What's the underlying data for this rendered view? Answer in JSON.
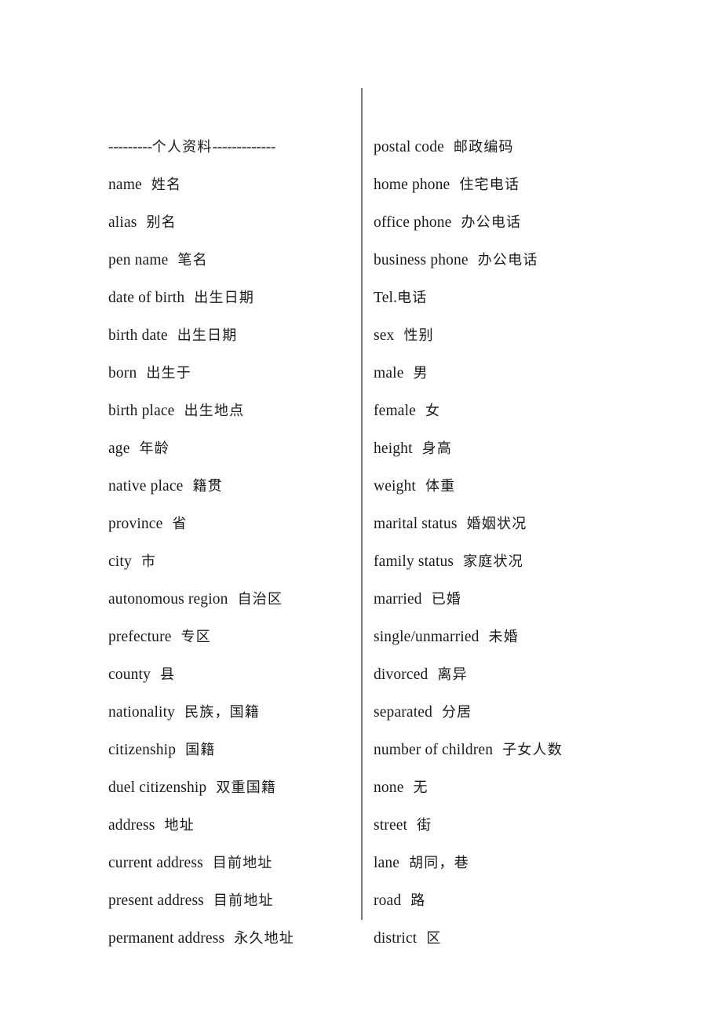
{
  "document": {
    "title": "个人资料 / Personal Information Glossary",
    "background_color": "#ffffff",
    "text_color": "#1a1a1a",
    "divider_color": "#777777"
  },
  "left_column": {
    "header": {
      "leading_dashes": "---------",
      "label": "个人资料",
      "trailing_dashes": "-------------"
    },
    "entries": [
      {
        "en": "name",
        "zh": "姓名",
        "sep": "wide"
      },
      {
        "en": "alias",
        "zh": "别名",
        "sep": "wide"
      },
      {
        "en": "pen name",
        "zh": "笔名",
        "sep": "wide"
      },
      {
        "en": "date of birth",
        "zh": "出生日期",
        "sep": "wide"
      },
      {
        "en": "birth date",
        "zh": "出生日期",
        "sep": "wide"
      },
      {
        "en": "born",
        "zh": "出生于",
        "sep": "wide"
      },
      {
        "en": "birth place",
        "zh": "出生地点",
        "sep": "wide"
      },
      {
        "en": "age",
        "zh": "年龄",
        "sep": "wide"
      },
      {
        "en": "native place",
        "zh": "籍贯",
        "sep": "wide"
      },
      {
        "en": "province",
        "zh": "省",
        "sep": "wide"
      },
      {
        "en": "city",
        "zh": "市",
        "sep": "wide"
      },
      {
        "en": "autonomous region",
        "zh": "自治区",
        "sep": "wide"
      },
      {
        "en": "prefecture",
        "zh": "专区",
        "sep": "wide"
      },
      {
        "en": "county",
        "zh": "县",
        "sep": "wide"
      },
      {
        "en": "nationality",
        "zh": "民族，国籍",
        "sep": "wide"
      },
      {
        "en": "citizenship",
        "zh": "国籍",
        "sep": "wide"
      },
      {
        "en": "duel citizenship",
        "zh": "双重国籍",
        "sep": "wide"
      },
      {
        "en": "address",
        "zh": "地址",
        "sep": "wide"
      },
      {
        "en": "current address",
        "zh": "目前地址",
        "sep": "wide"
      },
      {
        "en": "present address",
        "zh": "目前地址",
        "sep": "wide"
      },
      {
        "en": "permanent address",
        "zh": "永久地址",
        "sep": "wide"
      }
    ]
  },
  "right_column": {
    "entries": [
      {
        "en": "postal code",
        "zh": "邮政编码",
        "sep": "wide"
      },
      {
        "en": "home phone",
        "zh": "住宅电话",
        "sep": "wide"
      },
      {
        "en": "office phone",
        "zh": "办公电话",
        "sep": "wide"
      },
      {
        "en": "business phone",
        "zh": "办公电话",
        "sep": "wide"
      },
      {
        "en": "Tel.",
        "zh": "电话",
        "sep": "none"
      },
      {
        "en": "sex",
        "zh": "性别",
        "sep": "wide"
      },
      {
        "en": "male",
        "zh": "男",
        "sep": "wide"
      },
      {
        "en": "female",
        "zh": "女",
        "sep": "wide"
      },
      {
        "en": "height",
        "zh": "身高",
        "sep": "wide"
      },
      {
        "en": "weight",
        "zh": "体重",
        "sep": "wide"
      },
      {
        "en": "marital status",
        "zh": "婚姻状况",
        "sep": "wide"
      },
      {
        "en": "family status",
        "zh": "家庭状况",
        "sep": "wide"
      },
      {
        "en": "married",
        "zh": "已婚",
        "sep": "wide"
      },
      {
        "en": "single/unmarried",
        "zh": "未婚",
        "sep": "wide"
      },
      {
        "en": "divorced",
        "zh": "离异",
        "sep": "wide"
      },
      {
        "en": "separated",
        "zh": "分居",
        "sep": "wide"
      },
      {
        "en": "number of children",
        "zh": "子女人数",
        "sep": "wide"
      },
      {
        "en": "none",
        "zh": "无",
        "sep": "wide"
      },
      {
        "en": "street",
        "zh": "街",
        "sep": "wide"
      },
      {
        "en": "lane",
        "zh": "胡同，巷",
        "sep": "wide"
      },
      {
        "en": "road",
        "zh": "路",
        "sep": "wide"
      },
      {
        "en": "district",
        "zh": "区",
        "sep": "wide"
      }
    ]
  }
}
